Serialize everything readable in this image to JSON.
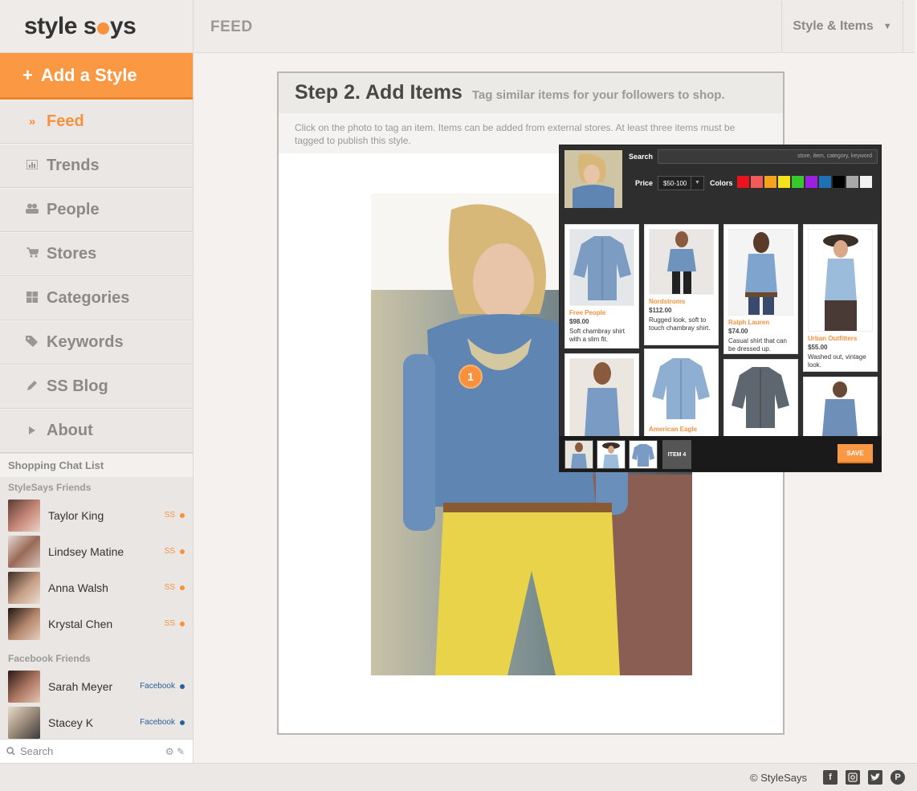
{
  "brand": {
    "name_part1": "style s",
    "name_part2": "ys"
  },
  "sidebar": {
    "add_style": "Add a Style",
    "items": [
      {
        "label": "Feed",
        "icon": "double-chevron-icon"
      },
      {
        "label": "Trends",
        "icon": "bar-chart-icon"
      },
      {
        "label": "People",
        "icon": "people-icon"
      },
      {
        "label": "Stores",
        "icon": "cart-icon"
      },
      {
        "label": "Categories",
        "icon": "grid-icon"
      },
      {
        "label": "Keywords",
        "icon": "tag-icon"
      },
      {
        "label": "SS Blog",
        "icon": "pencil-icon"
      },
      {
        "label": "About",
        "icon": "play-icon"
      }
    ]
  },
  "chat": {
    "title": "Shopping Chat List",
    "stylesays_group": "StyleSays Friends",
    "facebook_group": "Facebook Friends",
    "ss_label": "SS",
    "fb_label": "Facebook",
    "ss_friends": [
      {
        "name": "Taylor King"
      },
      {
        "name": "Lindsey Matine"
      },
      {
        "name": "Anna Walsh"
      },
      {
        "name": "Krystal Chen"
      }
    ],
    "fb_friends": [
      {
        "name": "Sarah Meyer"
      },
      {
        "name": "Stacey K"
      }
    ],
    "search_placeholder": "Search"
  },
  "header": {
    "title": "FEED",
    "dropdown": "Style & Items"
  },
  "step": {
    "title": "Step 2. Add Items",
    "subtitle": "Tag similar items for your followers to shop.",
    "instructions": "Click on the photo to tag an item. Items can be added from external stores. At least three items must be tagged to publish this style.",
    "tag_number": "1"
  },
  "popup": {
    "search_label": "Search",
    "search_placeholder": "store, item, category, keyword",
    "price_label": "Price",
    "price_value": "$50-100",
    "colors_label": "Colors",
    "colors": [
      "#e8141c",
      "#f05a5a",
      "#f5a11c",
      "#f5e11c",
      "#35c92b",
      "#9b20e0",
      "#1f6fb5",
      "#000000",
      "#a8a8a8",
      "#f2f2f2"
    ],
    "products": [
      {
        "store": "Free People",
        "price": "$98.00",
        "desc": "Soft chambray shirt with a slim fit."
      },
      {
        "store": "Nordstroms",
        "price": "$112.00",
        "desc": "Rugged look, soft to touch chambray shirt."
      },
      {
        "store": "Ralph Lauren",
        "price": "$74.00",
        "desc": "Casual shirt that can be dressed up."
      },
      {
        "store": "Urban Outfitters",
        "price": "$55.00",
        "desc": "Washed out, vintage look."
      },
      {
        "store": "",
        "price": "",
        "desc": ""
      },
      {
        "store": "American Eagle",
        "price": "",
        "desc": ""
      },
      {
        "store": "",
        "price": "",
        "desc": ""
      },
      {
        "store": "",
        "price": "",
        "desc": ""
      }
    ],
    "item4_label": "ITEM 4",
    "save_label": "SAVE"
  },
  "footer": {
    "copyright": "© StyleSays",
    "social": [
      "facebook-icon",
      "instagram-icon",
      "twitter-icon",
      "pinterest-icon"
    ]
  }
}
